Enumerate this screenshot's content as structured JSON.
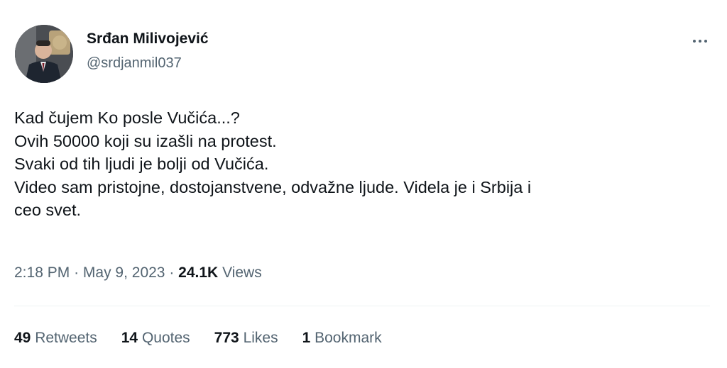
{
  "author": {
    "display_name": "Srđan Milivojević",
    "handle": "@srdjanmil037"
  },
  "tweet": {
    "lines": [
      "Kad čujem Ko posle Vučića...?",
      "Ovih 50000 koji su izašli na protest.",
      "Svaki od tih ljudi je bolji od Vučića.",
      "Video sam pristojne, dostojanstvene, odvažne ljude. Videla je i Srbija i",
      "ceo svet."
    ]
  },
  "meta": {
    "time": "2:18 PM",
    "separator": "·",
    "date": "May 9, 2023",
    "views_count": "24.1K",
    "views_label": "Views"
  },
  "stats": {
    "retweets": {
      "count": "49",
      "label": "Retweets"
    },
    "quotes": {
      "count": "14",
      "label": "Quotes"
    },
    "likes": {
      "count": "773",
      "label": "Likes"
    },
    "bookmarks": {
      "count": "1",
      "label": "Bookmark"
    }
  },
  "icons": {
    "more": "more-horizontal-icon"
  },
  "colors": {
    "text_primary": "#0f1419",
    "text_secondary": "#536471",
    "divider": "#eff3f4"
  }
}
